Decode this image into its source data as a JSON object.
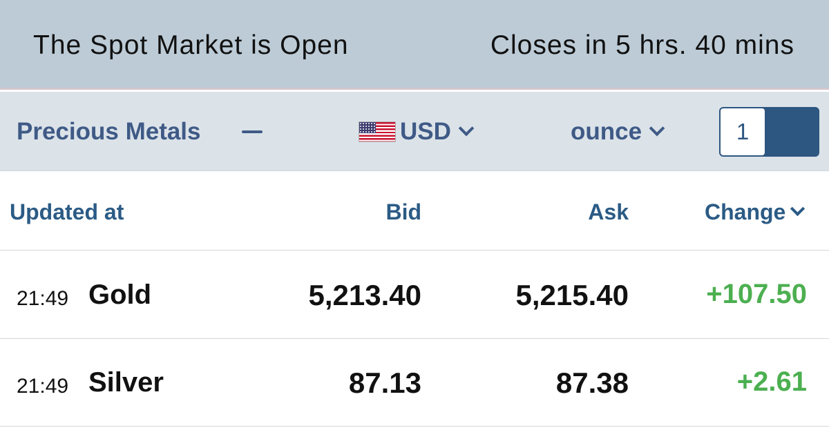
{
  "market": {
    "status": "The Spot Market is Open",
    "closes": "Closes in 5 hrs. 40 mins"
  },
  "filters": {
    "category": "Precious Metals",
    "currency": "USD",
    "currency_flag": "us-flag-icon",
    "unit": "ounce",
    "quantity": "1"
  },
  "table": {
    "headers": {
      "updated": "Updated at",
      "bid": "Bid",
      "ask": "Ask",
      "change": "Change"
    },
    "rows": [
      {
        "time": "21:49",
        "metal": "Gold",
        "bid": "5,213.40",
        "ask": "5,215.40",
        "change": "+107.50"
      },
      {
        "time": "21:49",
        "metal": "Silver",
        "bid": "87.13",
        "ask": "87.38",
        "change": "+2.61"
      }
    ]
  },
  "colors": {
    "status_bar_bg": "#bccbd6",
    "filter_bar_bg": "#dbe3e9",
    "accent": "#3f5a86",
    "header_text": "#2b5b85",
    "toggle": "#2d5680",
    "positive_change": "#4caf50"
  }
}
